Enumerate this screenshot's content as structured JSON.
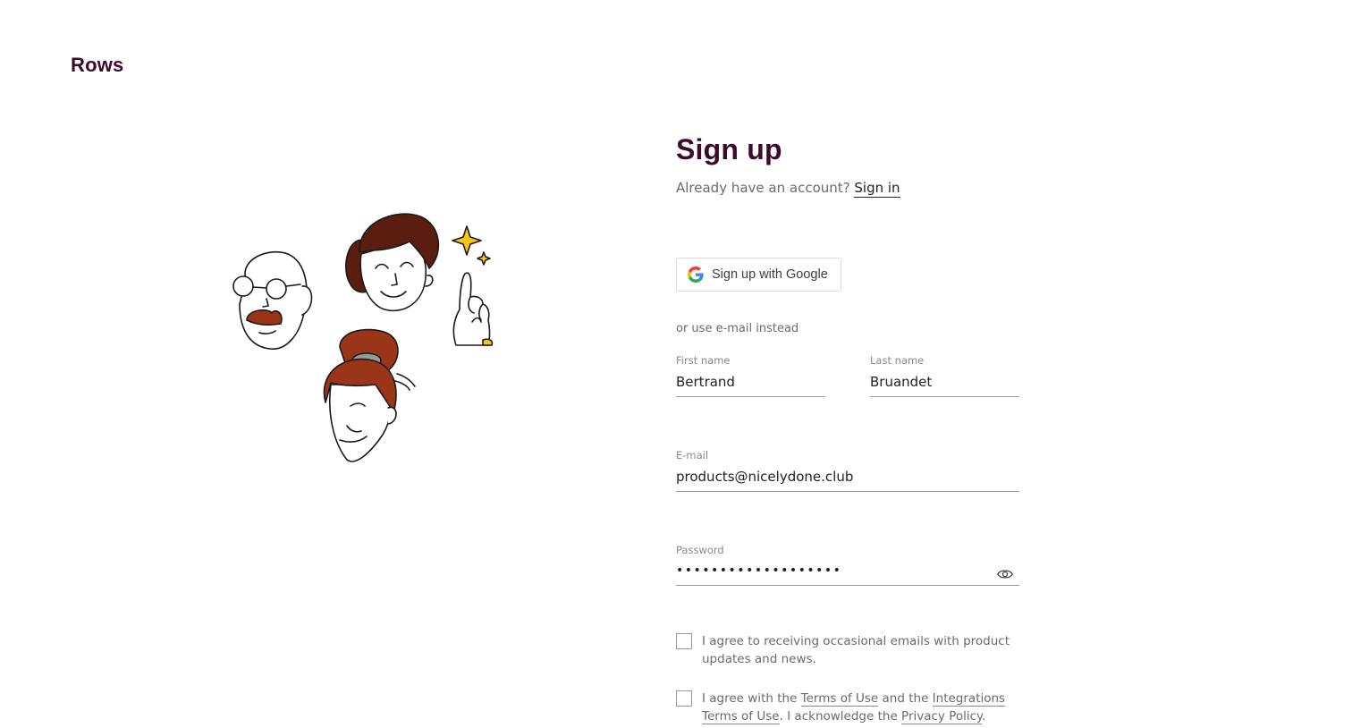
{
  "brand": {
    "logo_text": "Rows"
  },
  "signup": {
    "title": "Sign up",
    "already_text": "Already have an account?",
    "signin_link": "Sign in",
    "google_button": "Sign up with Google",
    "or_text": "or use e-mail instead",
    "fields": {
      "first_name": {
        "label": "First name",
        "value": "Bertrand"
      },
      "last_name": {
        "label": "Last name",
        "value": "Bruandet"
      },
      "email": {
        "label": "E-mail",
        "value": "products@nicelydone.club"
      },
      "password": {
        "label": "Password",
        "value": "•••••••••••••••••••",
        "icon": "eye-icon"
      }
    },
    "consent": {
      "emails_text": "I agree to receiving occasional emails with product updates and news.",
      "terms_prefix": "I agree with the ",
      "terms_link": "Terms of Use",
      "terms_middle": " and the ",
      "integrations_link": "Integrations Terms of Use",
      "terms_after": ". I acknowledge the ",
      "privacy_link": "Privacy Policy",
      "terms_end": "."
    }
  },
  "colors": {
    "brand": "#3b0a2d",
    "text_muted": "#6b6b6b",
    "border": "#9a9a9a",
    "illustration_brown_dark": "#5a1d0f",
    "illustration_brown_red": "#9a3518",
    "illustration_yellow": "#f5c518"
  }
}
